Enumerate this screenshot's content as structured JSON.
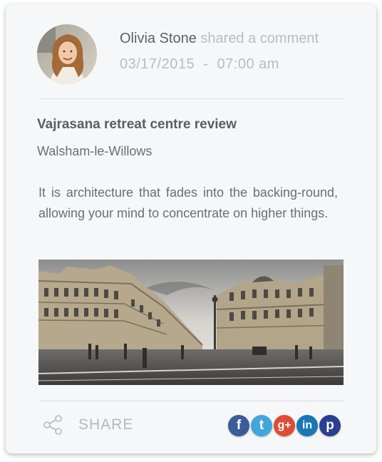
{
  "post": {
    "author_name": "Olivia Stone",
    "author_action": "shared a comment",
    "date": "03/17/2015",
    "date_separator": "-",
    "time": "07:00 am",
    "title": "Vajrasana retreat centre review",
    "location": "Walsham-le-Willows",
    "body": "It is architecture that fades into the backing-round, allowing your mind to concentrate on higher things."
  },
  "footer": {
    "share_label": "SHARE"
  },
  "social": [
    {
      "icon": "facebook-icon",
      "glyph": "f",
      "color": "#3b5b99"
    },
    {
      "icon": "twitter-icon",
      "glyph": "t",
      "color": "#3fa7db"
    },
    {
      "icon": "google-plus-icon",
      "glyph": "g+",
      "color": "#e04b35"
    },
    {
      "icon": "linkedin-icon",
      "glyph": "in",
      "color": "#1a77b6"
    },
    {
      "icon": "pinterest-icon",
      "glyph": "p",
      "color": "#2a3f8f"
    }
  ],
  "colors": {
    "card_background": "#f6f7f8",
    "text_dark": "#5b5e63",
    "text_light": "#b9bcc0"
  }
}
